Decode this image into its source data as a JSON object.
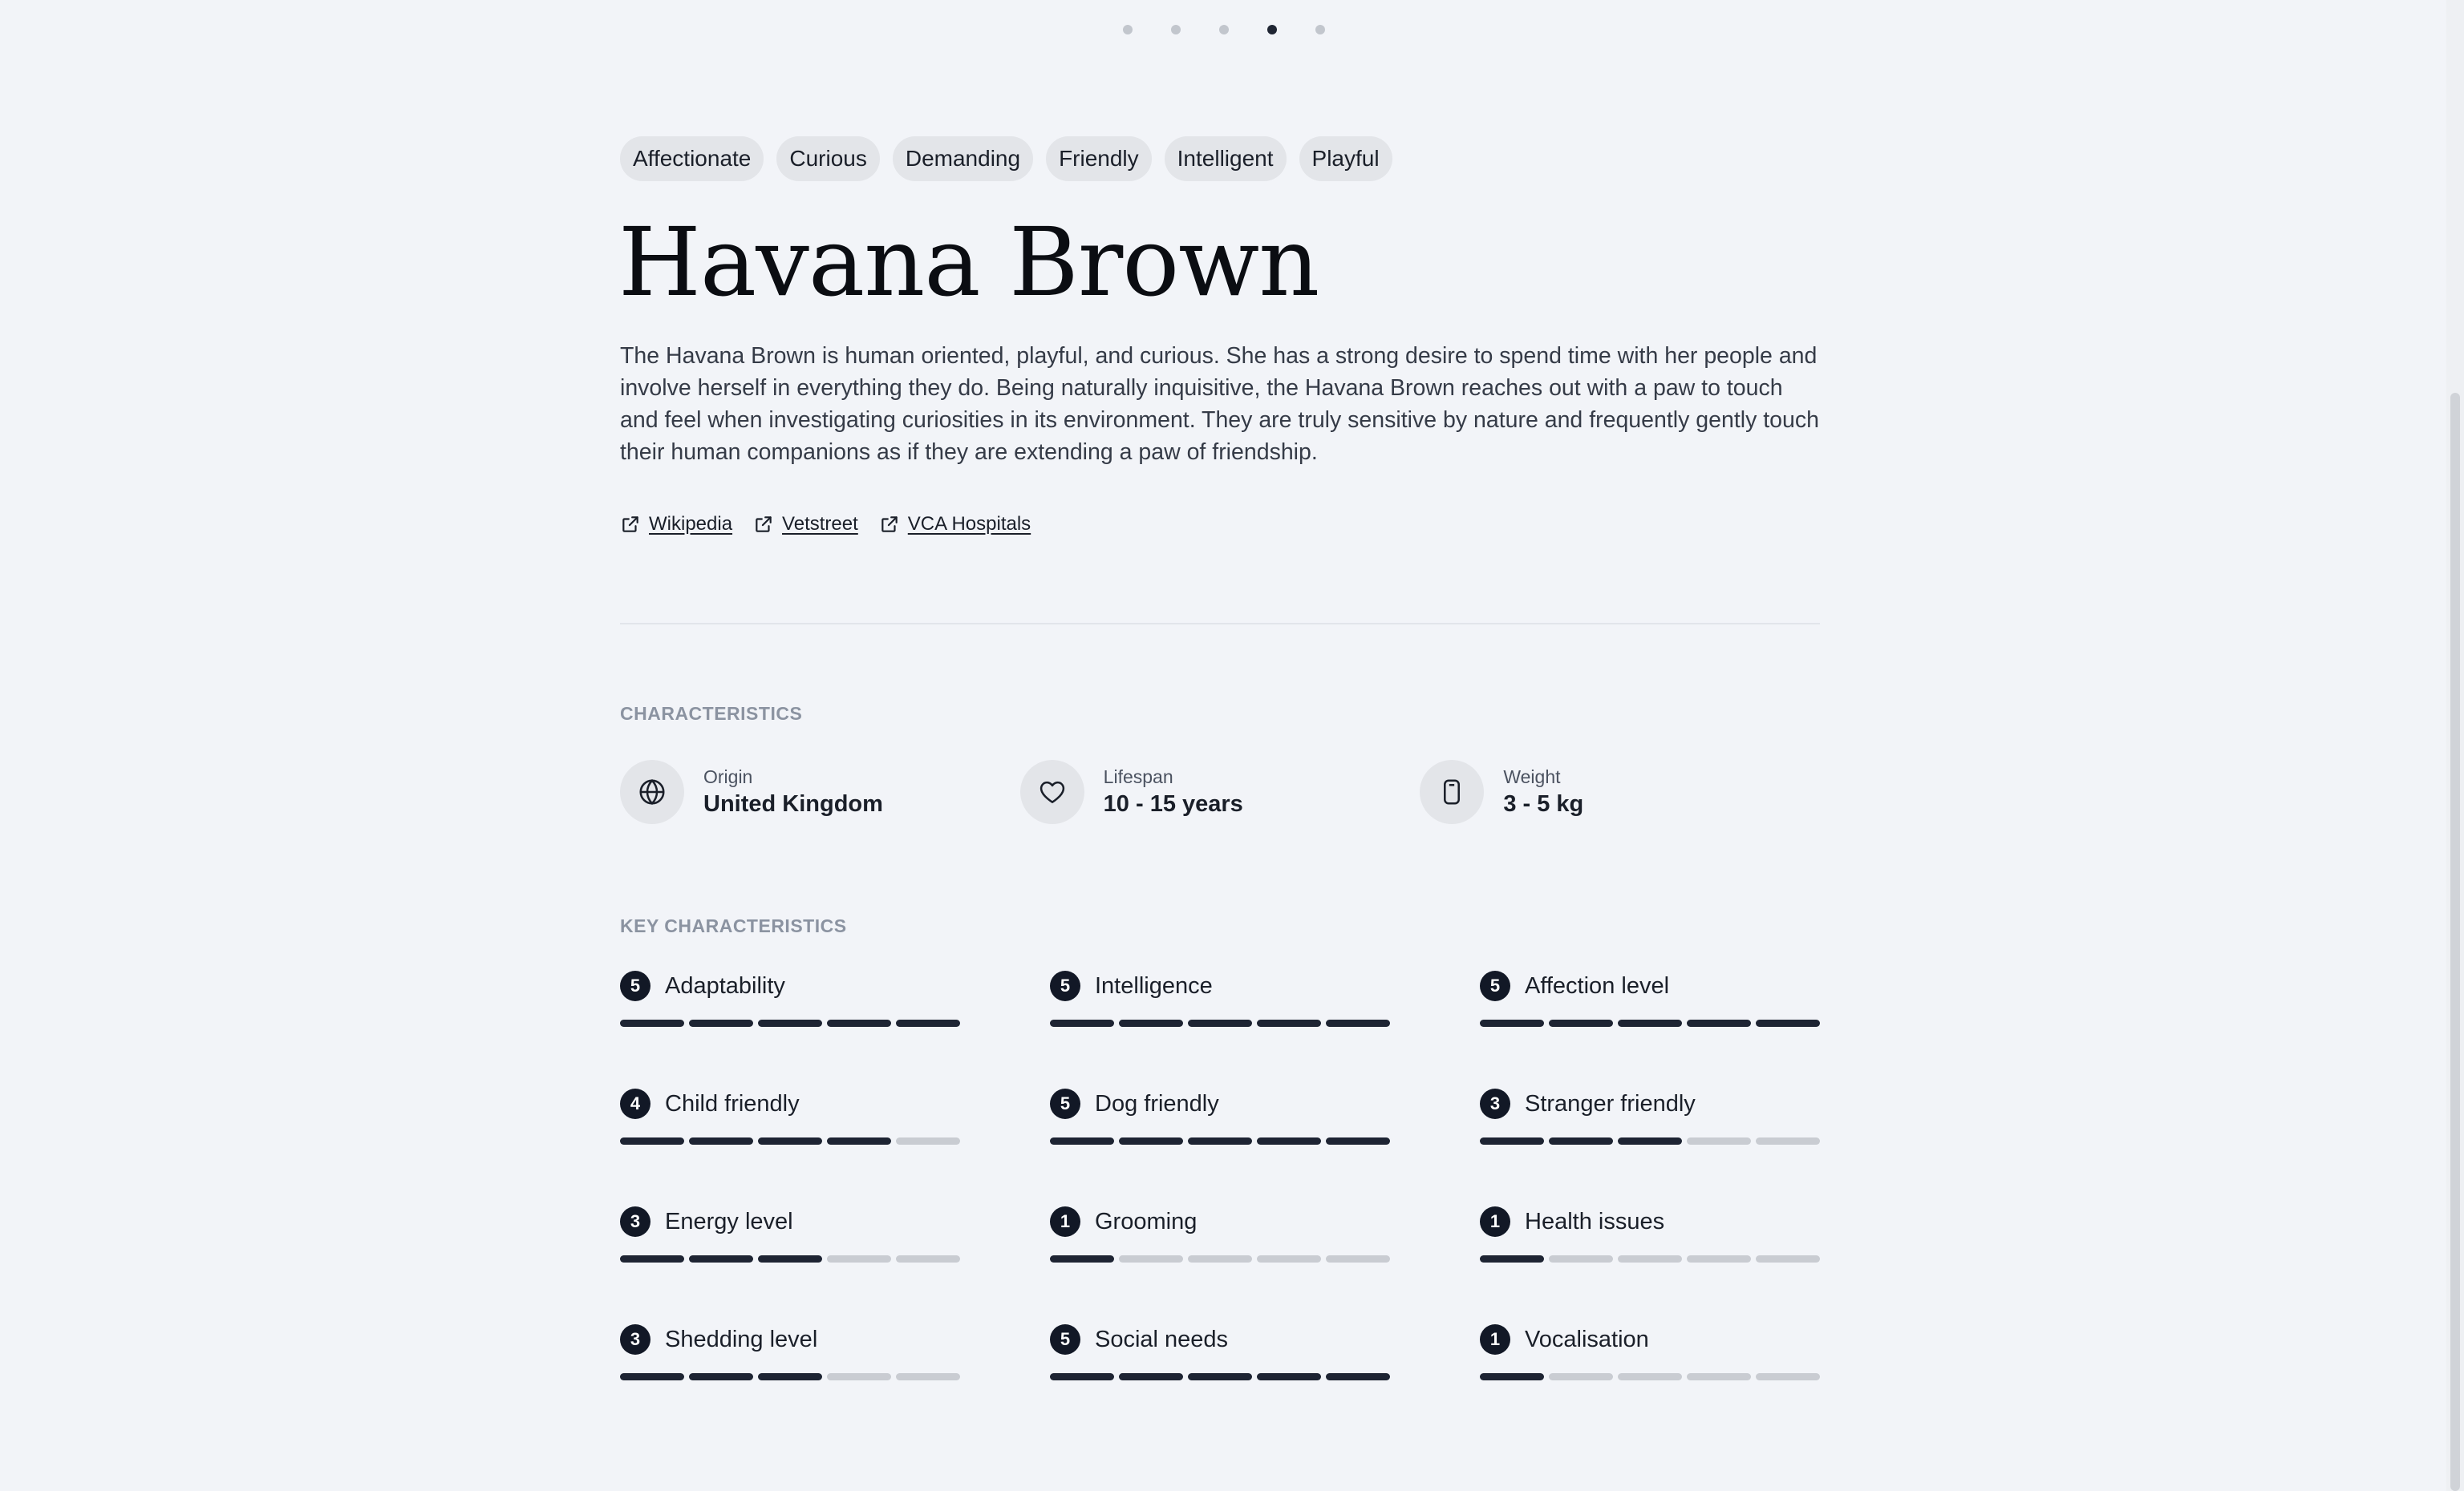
{
  "carousel": {
    "count": 5,
    "active_index": 3
  },
  "tags": [
    "Affectionate",
    "Curious",
    "Demanding",
    "Friendly",
    "Intelligent",
    "Playful"
  ],
  "title": "Havana Brown",
  "description": "The Havana Brown is human oriented, playful, and curious. She has a strong desire to spend time with her people and involve herself in everything they do. Being naturally inquisitive, the Havana Brown reaches out with a paw to touch and feel when investigating curiosities in its environment. They are truly sensitive by nature and frequently gently touch their human companions as if they are extending a paw of friendship.",
  "links": [
    {
      "label": "Wikipedia",
      "icon": "external-link-icon"
    },
    {
      "label": "Vetstreet",
      "icon": "external-link-icon"
    },
    {
      "label": "VCA Hospitals",
      "icon": "external-link-icon"
    }
  ],
  "characteristics": {
    "label": "CHARACTERISTICS",
    "items": [
      {
        "label": "Origin",
        "value": "United Kingdom",
        "icon": "globe-icon"
      },
      {
        "label": "Lifespan",
        "value": "10 - 15 years",
        "icon": "heart-icon"
      },
      {
        "label": "Weight",
        "value": "3 - 5 kg",
        "icon": "scale-icon"
      }
    ]
  },
  "key_characteristics": {
    "label": "KEY CHARACTERISTICS",
    "max": 5,
    "items": [
      {
        "name": "Adaptability",
        "score": "5"
      },
      {
        "name": "Intelligence",
        "score": "5"
      },
      {
        "name": "Affection level",
        "score": "5"
      },
      {
        "name": "Child friendly",
        "score": "4"
      },
      {
        "name": "Dog friendly",
        "score": "5"
      },
      {
        "name": "Stranger friendly",
        "score": "3"
      },
      {
        "name": "Energy level",
        "score": "3"
      },
      {
        "name": "Grooming",
        "score": "1"
      },
      {
        "name": "Health issues",
        "score": "1"
      },
      {
        "name": "Shedding level",
        "score": "3"
      },
      {
        "name": "Social needs",
        "score": "5"
      },
      {
        "name": "Vocalisation",
        "score": "1"
      }
    ]
  },
  "colors": {
    "background": "#f2f4f8",
    "accent_dark": "#121826",
    "bar_off": "#c9ccd2"
  }
}
